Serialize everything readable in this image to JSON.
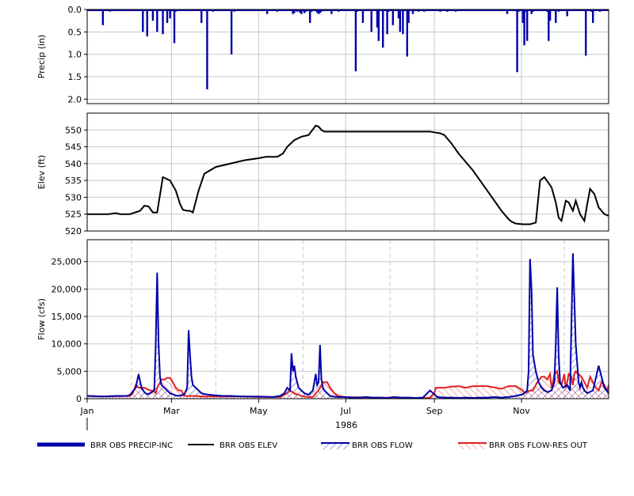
{
  "chart_data": [
    {
      "type": "bar",
      "panel": "precip",
      "ylabel": "Precip (in)",
      "ylim": [
        2.1,
        0.0
      ],
      "y_inverted": true,
      "yticks": [
        "0.0",
        "0.5",
        "1.0",
        "1.5",
        "2.0"
      ],
      "grid": true,
      "series": [
        {
          "name": "BRR OBS PRECIP-INC",
          "color": "#0000aa",
          "x": [
            3,
            4,
            10,
            11,
            16,
            31,
            39,
            42,
            46,
            49,
            53,
            56,
            58,
            61,
            62,
            68,
            80,
            84,
            88,
            101,
            103,
            115,
            118,
            126,
            133,
            139,
            144,
            145,
            147,
            148,
            149,
            150,
            152,
            153,
            155,
            156,
            157,
            159,
            160,
            161,
            162,
            163,
            164,
            165,
            171,
            176,
            181,
            185,
            188,
            189,
            193,
            199,
            203,
            204,
            207,
            210,
            211,
            214,
            218,
            219,
            221,
            224,
            225,
            228,
            232,
            236,
            241,
            247,
            249,
            252,
            258,
            261,
            268,
            273,
            278,
            283,
            288,
            291,
            294,
            301,
            302,
            305,
            306,
            307,
            308,
            311,
            312,
            322,
            323,
            324,
            327,
            328,
            330,
            336,
            345,
            349,
            350,
            353,
            354,
            359,
            362
          ],
          "values": [
            0.02,
            0.02,
            0.03,
            0.35,
            0.05,
            0.03,
            0.5,
            0.6,
            0.25,
            0.5,
            0.55,
            0.3,
            0.2,
            0.75,
            0.05,
            0.03,
            0.3,
            1.78,
            0.05,
            1.0,
            0.05,
            0.03,
            0.02,
            0.1,
            0.05,
            0.03,
            0.1,
            0.08,
            0.05,
            0.02,
            0.07,
            0.1,
            0.08,
            0.05,
            0.03,
            0.3,
            0.05,
            0.02,
            0.03,
            0.07,
            0.1,
            0.08,
            0.05,
            0.03,
            0.1,
            0.05,
            0.03,
            0.03,
            1.38,
            0.05,
            0.3,
            0.5,
            0.4,
            0.7,
            0.85,
            0.55,
            0.05,
            0.35,
            0.2,
            0.5,
            0.55,
            1.05,
            0.3,
            0.1,
            0.05,
            0.05,
            0.02,
            0.05,
            0.02,
            0.05,
            0.05,
            0.03,
            0.02,
            0.02,
            0.03,
            0.02,
            0.02,
            0.02,
            0.1,
            1.4,
            0.05,
            0.3,
            0.8,
            0.05,
            0.7,
            0.1,
            0.05,
            0.05,
            0.7,
            0.25,
            0.03,
            0.3,
            0.05,
            0.15,
            0.02,
            1.03,
            0.02,
            0.05,
            0.3,
            0.05,
            0.03
          ]
        }
      ]
    },
    {
      "type": "line",
      "panel": "elev",
      "ylabel": "Elev (ft)",
      "ylim": [
        520,
        555
      ],
      "yticks": [
        "520",
        "525",
        "530",
        "535",
        "540",
        "545",
        "550"
      ],
      "grid": true,
      "series": [
        {
          "name": "BRR OBS ELEV",
          "color": "#000000",
          "x": [
            0,
            15,
            20,
            23,
            30,
            37,
            40,
            43,
            46,
            49,
            53,
            58,
            62,
            65,
            67,
            70,
            72,
            74,
            78,
            82,
            90,
            100,
            110,
            120,
            125,
            133,
            137,
            140,
            145,
            150,
            155,
            160,
            162,
            164,
            166,
            168,
            170,
            180,
            190,
            200,
            210,
            220,
            230,
            240,
            243,
            247,
            250,
            255,
            260,
            270,
            280,
            290,
            295,
            297,
            300,
            305,
            310,
            314,
            317,
            320,
            325,
            328,
            330,
            332,
            335,
            337,
            340,
            342,
            345,
            348,
            350,
            352,
            355,
            358,
            362,
            365
          ],
          "values": [
            525,
            525,
            525.3,
            525,
            525,
            526,
            527.5,
            527.3,
            525.5,
            525.5,
            536,
            535,
            532,
            528,
            526.3,
            526,
            526,
            525.5,
            532,
            537,
            539,
            540,
            541,
            541.6,
            542,
            542,
            543,
            545,
            547,
            548,
            548.5,
            551.3,
            551,
            550,
            549.5,
            549.5,
            549.5,
            549.5,
            549.5,
            549.5,
            549.5,
            549.5,
            549.5,
            549.5,
            549.3,
            549,
            548.5,
            546,
            543,
            538,
            532,
            526,
            523.5,
            522.8,
            522.2,
            522,
            522,
            522.5,
            535,
            536,
            533,
            528.5,
            524,
            523,
            529,
            528.5,
            526,
            529,
            525,
            523,
            528,
            532.5,
            531,
            527,
            525,
            524.5
          ]
        }
      ]
    },
    {
      "type": "area",
      "panel": "flow",
      "ylabel": "Flow (cfs)",
      "ylim": [
        0,
        29000
      ],
      "yticks": [
        "0",
        "5,000",
        "10,000",
        "15,000",
        "20,000",
        "25,000"
      ],
      "grid": true,
      "xlabel": "1986",
      "xticks": [
        {
          "label": "Jan",
          "day": 0
        },
        {
          "label": "Mar",
          "day": 59
        },
        {
          "label": "May",
          "day": 120
        },
        {
          "label": "Jul",
          "day": 181
        },
        {
          "label": "Sep",
          "day": 243
        },
        {
          "label": "Nov",
          "day": 304
        }
      ],
      "series": [
        {
          "name": "BRR OBS FLOW",
          "color": "#0000aa",
          "x": [
            0,
            10,
            20,
            28,
            30,
            34,
            36,
            38,
            40,
            42,
            44,
            47,
            48,
            49,
            50,
            51,
            52,
            54,
            56,
            58,
            60,
            62,
            64,
            68,
            70,
            71,
            72,
            73,
            74,
            76,
            78,
            80,
            83,
            86,
            90,
            95,
            100,
            110,
            120,
            130,
            135,
            138,
            140,
            142,
            143,
            144,
            145,
            146,
            147,
            148,
            150,
            152,
            155,
            158,
            160,
            161,
            162,
            163,
            164,
            165,
            166,
            168,
            170,
            172,
            175,
            180,
            185,
            190,
            195,
            200,
            205,
            210,
            215,
            220,
            225,
            230,
            235,
            240,
            245,
            250,
            255,
            260,
            265,
            270,
            275,
            280,
            285,
            290,
            295,
            300,
            305,
            308,
            309,
            310,
            311,
            312,
            314,
            316,
            318,
            320,
            322,
            325,
            327,
            328,
            329,
            330,
            331,
            333,
            336,
            338,
            340,
            342,
            344,
            345,
            346,
            347,
            348,
            350,
            354,
            358,
            360,
            362,
            365
          ],
          "values": [
            500,
            400,
            500,
            500,
            700,
            2000,
            4500,
            2000,
            1200,
            800,
            1000,
            1500,
            10000,
            23000,
            10000,
            4000,
            2500,
            2000,
            1500,
            1000,
            800,
            600,
            500,
            800,
            2000,
            12500,
            8000,
            4000,
            2500,
            2000,
            1500,
            1000,
            800,
            700,
            600,
            500,
            500,
            400,
            400,
            300,
            500,
            1000,
            2000,
            1500,
            8300,
            5000,
            6000,
            4000,
            3000,
            2000,
            1500,
            1000,
            700,
            1500,
            4500,
            2500,
            3000,
            9800,
            3500,
            2000,
            1500,
            1000,
            500,
            400,
            300,
            300,
            200,
            200,
            300,
            200,
            200,
            150,
            300,
            200,
            200,
            150,
            200,
            1500,
            300,
            200,
            200,
            150,
            200,
            150,
            200,
            200,
            300,
            200,
            300,
            500,
            800,
            1500,
            5000,
            25500,
            20000,
            8000,
            5000,
            3000,
            2000,
            1500,
            1200,
            1500,
            3000,
            10000,
            20300,
            8000,
            3000,
            2000,
            2500,
            1500,
            26500,
            10000,
            3000,
            2000,
            3000,
            2000,
            1500,
            1000,
            1500,
            6000,
            4000,
            2000,
            1000
          ]
        },
        {
          "name": "BRR OBS FLOW-RES OUT",
          "color": "#e02020",
          "x": [
            0,
            15,
            30,
            32,
            34,
            36,
            40,
            44,
            46,
            48,
            49,
            50,
            52,
            54,
            56,
            58,
            60,
            62,
            64,
            66,
            68,
            72,
            76,
            80,
            90,
            100,
            110,
            120,
            130,
            135,
            140,
            142,
            145,
            150,
            155,
            158,
            160,
            162,
            165,
            168,
            170,
            173,
            176,
            180,
            200,
            220,
            240,
            243,
            244,
            250,
            255,
            260,
            265,
            270,
            280,
            290,
            295,
            298,
            300,
            305,
            306,
            308,
            310,
            312,
            315,
            318,
            320,
            322,
            324,
            325,
            326,
            327,
            329,
            330,
            332,
            334,
            335,
            336,
            337,
            339,
            340,
            341,
            342,
            344,
            346,
            348,
            350,
            352,
            354,
            356,
            358,
            360,
            362,
            364,
            365
          ],
          "values": [
            500,
            400,
            500,
            1000,
            2500,
            2000,
            2000,
            1500,
            1500,
            1000,
            2000,
            2500,
            3500,
            3500,
            3800,
            3800,
            3000,
            2000,
            1500,
            1500,
            500,
            500,
            500,
            400,
            400,
            400,
            400,
            300,
            300,
            300,
            1000,
            1500,
            1000,
            500,
            300,
            300,
            1000,
            1500,
            3000,
            3000,
            2000,
            1000,
            500,
            300,
            200,
            150,
            150,
            1000,
            2000,
            2000,
            2200,
            2300,
            2000,
            2300,
            2300,
            1800,
            2300,
            2300,
            2300,
            1500,
            1000,
            1200,
            1500,
            1500,
            3000,
            4000,
            4000,
            3500,
            4500,
            2000,
            3000,
            4500,
            5000,
            3000,
            2500,
            4500,
            2000,
            3000,
            4500,
            4000,
            2500,
            4500,
            5000,
            4500,
            4000,
            3000,
            2000,
            4000,
            3000,
            2000,
            1500,
            3000,
            2500,
            1500,
            2500
          ]
        }
      ]
    }
  ]
}
